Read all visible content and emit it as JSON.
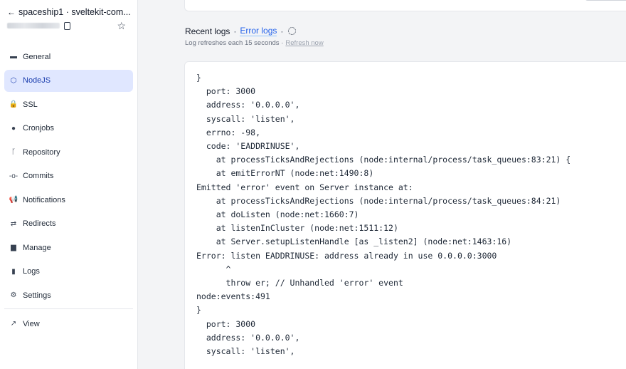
{
  "sidebar": {
    "site_title": "spaceship1 · sveltekit-com...",
    "back_icon": "arrow-left-icon",
    "items": [
      {
        "label": "General",
        "icon": "browser-icon",
        "glyph": "▬",
        "active": false
      },
      {
        "label": "NodeJS",
        "icon": "nodejs-icon",
        "glyph": "⬡",
        "active": true
      },
      {
        "label": "SSL",
        "icon": "lock-icon",
        "glyph": "🔒",
        "active": false
      },
      {
        "label": "Cronjobs",
        "icon": "clock-icon",
        "glyph": "●",
        "active": false
      },
      {
        "label": "Repository",
        "icon": "branch-icon",
        "glyph": "ᚴ",
        "active": false
      },
      {
        "label": "Commits",
        "icon": "commit-icon",
        "glyph": "-o-",
        "active": false
      },
      {
        "label": "Notifications",
        "icon": "megaphone-icon",
        "glyph": "📢",
        "active": false
      },
      {
        "label": "Redirects",
        "icon": "arrows-exchange-icon",
        "glyph": "⇄",
        "active": false
      },
      {
        "label": "Manage",
        "icon": "briefcase-icon",
        "glyph": "▆",
        "active": false
      },
      {
        "label": "Logs",
        "icon": "document-icon",
        "glyph": "▮",
        "active": false
      },
      {
        "label": "Settings",
        "icon": "gears-icon",
        "glyph": "⚙",
        "active": false
      }
    ],
    "footer_item": {
      "label": "View",
      "icon": "external-link-icon",
      "glyph": "↗"
    }
  },
  "logs": {
    "title": "Recent logs",
    "separator": "·",
    "error_link": "Error logs",
    "refresh_info": "Log refreshes each 15 seconds ·",
    "refresh_now": "Refresh now",
    "lines": [
      "}",
      "  port: 3000",
      "  address: '0.0.0.0',",
      "  syscall: 'listen',",
      "  errno: -98,",
      "  code: 'EADDRINUSE',",
      "    at processTicksAndRejections (node:internal/process/task_queues:83:21) {",
      "    at emitErrorNT (node:net:1490:8)",
      "Emitted 'error' event on Server instance at:",
      "    at processTicksAndRejections (node:internal/process/task_queues:84:21)",
      "    at doListen (node:net:1660:7)",
      "    at listenInCluster (node:net:1511:12)",
      "    at Server.setupListenHandle [as _listen2] (node:net:1463:16)",
      "Error: listen EADDRINUSE: address already in use 0.0.0.0:3000",
      "      ^",
      "      throw er; // Unhandled 'error' event",
      "node:events:491",
      "}",
      "  port: 3000",
      "  address: '0.0.0.0',",
      "  syscall: 'listen',"
    ]
  },
  "colors": {
    "accent": "#2563eb",
    "active_bg": "#e0e7ff",
    "active_text": "#1e40af"
  }
}
